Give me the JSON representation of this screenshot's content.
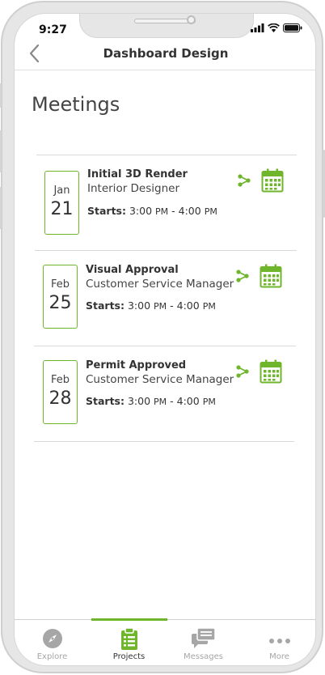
{
  "status_bar": {
    "time": "9:27"
  },
  "header": {
    "title": "Dashboard Design"
  },
  "page": {
    "title": "Meetings"
  },
  "meetings": [
    {
      "month": "Jan",
      "day": "21",
      "title": "Initial 3D Render",
      "role": "Interior Designer",
      "starts_label": "Starts:",
      "start": "3:00",
      "start_ampm": "PM",
      "sep": " - ",
      "end": "4:00",
      "end_ampm": "PM"
    },
    {
      "month": "Feb",
      "day": "25",
      "title": "Visual Approval",
      "role": "Customer Service Manager",
      "starts_label": "Starts:",
      "start": "3:00",
      "start_ampm": "PM",
      "sep": " - ",
      "end": "4:00",
      "end_ampm": "PM"
    },
    {
      "month": "Feb",
      "day": "28",
      "title": "Permit Approved",
      "role": "Customer Service Manager",
      "starts_label": "Starts:",
      "start": "3:00",
      "start_ampm": "PM",
      "sep": " - ",
      "end": "4:00",
      "end_ampm": "PM"
    }
  ],
  "tabs": [
    {
      "label": "Explore",
      "icon": "compass-icon",
      "active": false
    },
    {
      "label": "Projects",
      "icon": "clipboard-icon",
      "active": true
    },
    {
      "label": "Messages",
      "icon": "chat-icon",
      "active": false
    },
    {
      "label": "More",
      "icon": "more-dots-icon",
      "active": false
    }
  ],
  "colors": {
    "accent": "#6fb62d",
    "text": "#333333",
    "muted": "#a6a6a6",
    "divider": "#d9d9d9"
  }
}
